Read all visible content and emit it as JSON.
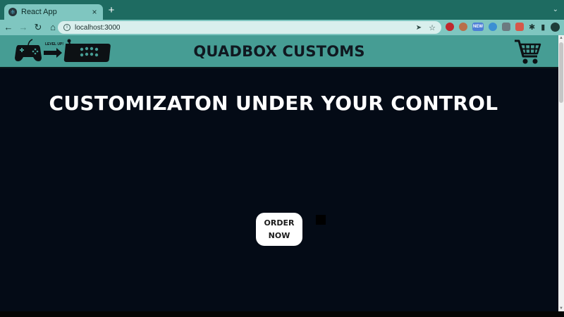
{
  "browser": {
    "tab_title": "React App",
    "tab_close": "×",
    "new_tab": "+",
    "url": "localhost:3000",
    "ext_new_badge": "NEW"
  },
  "header": {
    "logo_text": "LEVEL UP!",
    "title": "QUADBOX CUSTOMS"
  },
  "hero": {
    "title": "CUSTOMIZATON UNDER YOUR CONTROL",
    "cta_label": "ORDER NOW"
  },
  "colors": {
    "tabstrip": "#1e6b61",
    "toolbar": "#7fc6c0",
    "header": "#469d94",
    "page_bg": "#040b16",
    "button_bg": "#ffffff"
  },
  "icons": [
    "react-favicon",
    "back-arrow-icon",
    "forward-arrow-icon",
    "reload-icon",
    "home-icon",
    "info-icon",
    "share-icon",
    "star-icon",
    "extensions-icon",
    "side-panel-icon",
    "profile-avatar-icon",
    "menu-dots-icon",
    "controller-logo-icon",
    "shopping-cart-icon"
  ]
}
